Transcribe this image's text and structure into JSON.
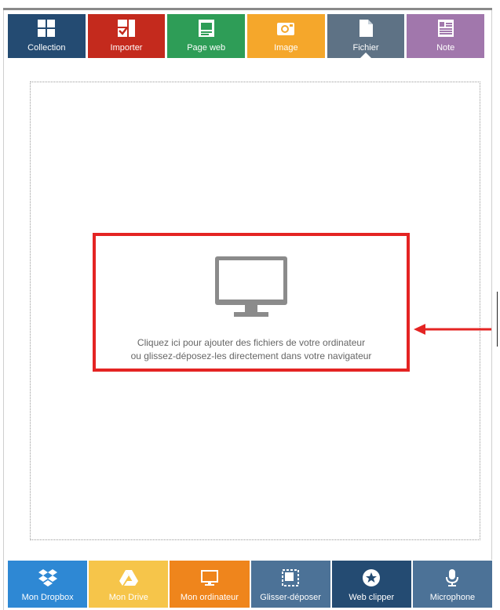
{
  "tabs": [
    {
      "label": "Collection",
      "icon": "grid-icon",
      "color": "#244b72",
      "active": false
    },
    {
      "label": "Importer",
      "icon": "import-icon",
      "color": "#c42a1d",
      "active": false
    },
    {
      "label": "Page web",
      "icon": "web-page-icon",
      "color": "#2e9d57",
      "active": false
    },
    {
      "label": "Image",
      "icon": "camera-icon",
      "color": "#f5a72b",
      "active": false
    },
    {
      "label": "Fichier",
      "icon": "file-icon",
      "color": "#5e7285",
      "active": true
    },
    {
      "label": "Note",
      "icon": "note-icon",
      "color": "#a177ac",
      "active": false
    }
  ],
  "dropzone": {
    "icon": "monitor-icon",
    "line1": "Cliquez ici pour ajouter des fichiers de votre ordinateur",
    "line2": "ou glissez-déposez-les directement dans votre navigateur",
    "highlight_color": "#e42423"
  },
  "toolbar": [
    {
      "label": "Mon Dropbox",
      "icon": "dropbox-icon",
      "color": "#2e88d4"
    },
    {
      "label": "Mon Drive",
      "icon": "drive-icon",
      "color": "#f6c54a"
    },
    {
      "label": "Mon ordinateur",
      "icon": "computer-icon",
      "color": "#ef851c"
    },
    {
      "label": "Glisser-déposer",
      "icon": "drag-drop-icon",
      "color": "#4c7297"
    },
    {
      "label": "Web clipper",
      "icon": "star-icon",
      "color": "#244b72"
    },
    {
      "label": "Microphone",
      "icon": "microphone-icon",
      "color": "#4c7297"
    }
  ]
}
